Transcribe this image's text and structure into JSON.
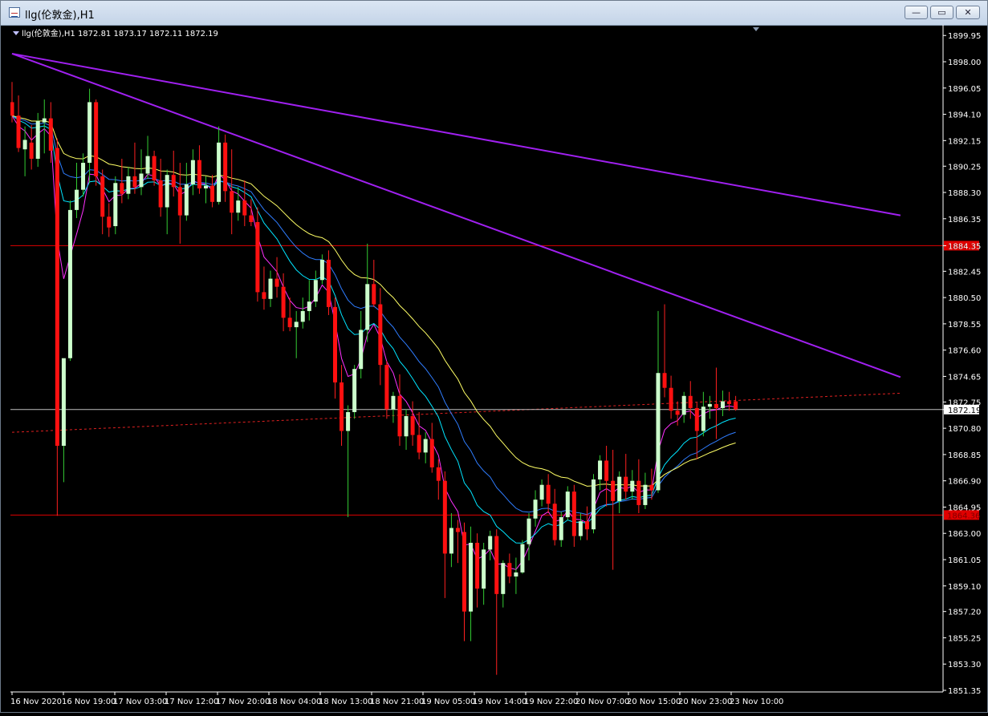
{
  "window": {
    "title": "llg(伦敦金),H1",
    "buttons": {
      "minimize": "—",
      "restore": "▭",
      "close": "✕"
    }
  },
  "chart_data": {
    "type": "candlestick",
    "info_line": "llg(伦敦金),H1  1872.81 1873.17 1872.11 1872.19",
    "ylim": [
      1851.35,
      1900.5
    ],
    "y_ticks": [
      "1899.95",
      "1898.00",
      "1896.05",
      "1894.10",
      "1892.15",
      "1890.25",
      "1888.30",
      "1886.35",
      "1884.35",
      "1882.45",
      "1880.50",
      "1878.55",
      "1876.60",
      "1874.65",
      "1872.75",
      "1872.19",
      "1870.80",
      "1868.85",
      "1866.90",
      "1864.95",
      "1863.00",
      "1861.05",
      "1859.10",
      "1857.20",
      "1855.25",
      "1853.30",
      "1851.35"
    ],
    "x_ticks": [
      "16 Nov 2020",
      "16 Nov 19:00",
      "17 Nov 03:00",
      "17 Nov 12:00",
      "17 Nov 20:00",
      "18 Nov 04:00",
      "18 Nov 13:00",
      "18 Nov 21:00",
      "19 Nov 05:00",
      "19 Nov 14:00",
      "19 Nov 22:00",
      "20 Nov 07:00",
      "20 Nov 15:00",
      "20 Nov 23:00",
      "23 Nov 10:00"
    ],
    "current_price": 1872.19,
    "horizontal_levels": [
      {
        "label": "1884.35",
        "value": 1884.35,
        "color": "#e00000"
      },
      {
        "label": "1864.36",
        "value": 1864.36,
        "color": "#e00000"
      }
    ],
    "trend_lines": [
      {
        "from": [
          0,
          1898.6
        ],
        "to": [
          137.5,
          1886.6
        ],
        "color": "#a020f0"
      },
      {
        "from": [
          0,
          1898.6
        ],
        "to": [
          137.5,
          1874.6
        ],
        "color": "#a020f0"
      },
      {
        "from": [
          0,
          1870.5
        ],
        "to": [
          137.5,
          1873.4
        ],
        "color": "#e02020",
        "dashed": true
      }
    ],
    "ma_colors": [
      "#ff30ff",
      "#00e5ff",
      "#2f7dff",
      "#ffff66"
    ],
    "bull_color": "#ccffcc",
    "bear_color": "#ff1010",
    "candles": [
      [
        1895,
        1896.5,
        1893.5,
        1894
      ],
      [
        1894,
        1895.5,
        1891.3,
        1891.6
      ],
      [
        1891.5,
        1893.2,
        1889.5,
        1892.2
      ],
      [
        1892,
        1893.3,
        1890,
        1890.8
      ],
      [
        1890.8,
        1894.2,
        1890.2,
        1893.6
      ],
      [
        1893.5,
        1895.2,
        1891.2,
        1893.8
      ],
      [
        1893.8,
        1895,
        1890.5,
        1891.4
      ],
      [
        1891.6,
        1892.3,
        1864.3,
        1869.5
      ],
      [
        1869.5,
        1875.5,
        1866.8,
        1876
      ],
      [
        1876,
        1887.7,
        1875.8,
        1887
      ],
      [
        1887,
        1890.5,
        1886.4,
        1888.5
      ],
      [
        1888.5,
        1891.2,
        1888,
        1890.5
      ],
      [
        1890.5,
        1896,
        1889,
        1895
      ],
      [
        1895,
        1895.2,
        1888.8,
        1889.5
      ],
      [
        1889.5,
        1890,
        1885.2,
        1886.5
      ],
      [
        1886.5,
        1887.5,
        1885,
        1885.7
      ],
      [
        1885.8,
        1889.5,
        1885.2,
        1889
      ],
      [
        1889,
        1890.8,
        1887.5,
        1888.2
      ],
      [
        1888.2,
        1890.2,
        1887.8,
        1889.5
      ],
      [
        1889.5,
        1892,
        1888.2,
        1888.7
      ],
      [
        1888.7,
        1891.5,
        1888.1,
        1889.7
      ],
      [
        1889.7,
        1892.5,
        1889.3,
        1891
      ],
      [
        1891,
        1891.4,
        1888.8,
        1889.2
      ],
      [
        1889.2,
        1890.8,
        1886.5,
        1887.2
      ],
      [
        1887.2,
        1890,
        1885.2,
        1889.6
      ],
      [
        1889.6,
        1891.4,
        1888,
        1888.7
      ],
      [
        1888.7,
        1890.5,
        1884.5,
        1886.6
      ],
      [
        1886.6,
        1890.5,
        1886.2,
        1888.9
      ],
      [
        1888.9,
        1891.5,
        1888.1,
        1890.7
      ],
      [
        1890.7,
        1891.8,
        1888.2,
        1888.6
      ],
      [
        1888.6,
        1889.5,
        1887.5,
        1888.8
      ],
      [
        1888.8,
        1889.6,
        1887.2,
        1887.6
      ],
      [
        1887.6,
        1893.2,
        1887.4,
        1892
      ],
      [
        1892,
        1892.6,
        1887.6,
        1888.4
      ],
      [
        1888.4,
        1891.5,
        1885.2,
        1886.8
      ],
      [
        1886.8,
        1888.7,
        1886.2,
        1887.7
      ],
      [
        1887.7,
        1889.2,
        1885.8,
        1886.6
      ],
      [
        1886.6,
        1887.8,
        1885.8,
        1886.1
      ],
      [
        1886.1,
        1887.2,
        1880.2,
        1880.9
      ],
      [
        1880.9,
        1882.8,
        1879.6,
        1880.4
      ],
      [
        1880.4,
        1882.5,
        1879.8,
        1881.9
      ],
      [
        1881.9,
        1883.5,
        1880.5,
        1881.3
      ],
      [
        1881.3,
        1882.3,
        1878,
        1879
      ],
      [
        1879,
        1880.5,
        1878,
        1878.3
      ],
      [
        1878.3,
        1879.5,
        1876,
        1878.7
      ],
      [
        1878.7,
        1880.5,
        1878.2,
        1879.5
      ],
      [
        1879.5,
        1881.8,
        1878.8,
        1880.2
      ],
      [
        1880.2,
        1882.5,
        1879.8,
        1881.8
      ],
      [
        1881.8,
        1883.7,
        1881.5,
        1883.3
      ],
      [
        1883.3,
        1884,
        1879.2,
        1879.8
      ],
      [
        1879.8,
        1880.5,
        1873,
        1874.2
      ],
      [
        1874.2,
        1875.5,
        1869.5,
        1870.6
      ],
      [
        1870.6,
        1872.5,
        1864.2,
        1872
      ],
      [
        1872,
        1875.5,
        1871.5,
        1875.2
      ],
      [
        1875.2,
        1879.5,
        1874.5,
        1878.1
      ],
      [
        1878.1,
        1884.5,
        1877.2,
        1881.5
      ],
      [
        1881.5,
        1883.3,
        1879.8,
        1880
      ],
      [
        1880,
        1881.2,
        1874,
        1875.5
      ],
      [
        1875.5,
        1875.8,
        1871.5,
        1872.2
      ],
      [
        1872.2,
        1873.5,
        1871.2,
        1873.2
      ],
      [
        1873.2,
        1874.8,
        1869.5,
        1870.2
      ],
      [
        1870.2,
        1872.2,
        1869.2,
        1871.7
      ],
      [
        1871.7,
        1872.8,
        1869.5,
        1870.3
      ],
      [
        1870.3,
        1872,
        1868.5,
        1869
      ],
      [
        1869,
        1870.5,
        1868.2,
        1870
      ],
      [
        1870,
        1871.2,
        1867.5,
        1867.9
      ],
      [
        1867.9,
        1868.5,
        1865.5,
        1866.9
      ],
      [
        1866.9,
        1867.6,
        1858.2,
        1861.5
      ],
      [
        1861.5,
        1864.5,
        1860.5,
        1863.4
      ],
      [
        1863.4,
        1864,
        1860.8,
        1863.1
      ],
      [
        1863.1,
        1863.8,
        1855,
        1857.2
      ],
      [
        1857.2,
        1863.5,
        1855,
        1862.3
      ],
      [
        1862.3,
        1863,
        1857.5,
        1858.9
      ],
      [
        1858.9,
        1862.3,
        1857.7,
        1861.8
      ],
      [
        1861.8,
        1863.2,
        1861,
        1862.8
      ],
      [
        1862.8,
        1863.3,
        1852.5,
        1858.5
      ],
      [
        1858.5,
        1861,
        1857.5,
        1860.8
      ],
      [
        1860.8,
        1861.5,
        1859.3,
        1859.8
      ],
      [
        1859.8,
        1861.2,
        1858.5,
        1860.1
      ],
      [
        1860.1,
        1862.5,
        1860,
        1862.2
      ],
      [
        1862.2,
        1864.5,
        1861,
        1864.1
      ],
      [
        1864.1,
        1866.2,
        1863.5,
        1865.5
      ],
      [
        1865.5,
        1867,
        1865,
        1866.6
      ],
      [
        1866.6,
        1867.4,
        1864.5,
        1865.2
      ],
      [
        1865.2,
        1866.3,
        1862.1,
        1862.5
      ],
      [
        1862.5,
        1864.6,
        1862,
        1864.2
      ],
      [
        1864.2,
        1866.5,
        1864,
        1866.1
      ],
      [
        1866.1,
        1866.6,
        1862,
        1862.8
      ],
      [
        1862.8,
        1864.5,
        1862.5,
        1863.9
      ],
      [
        1863.9,
        1865,
        1862.5,
        1863.3
      ],
      [
        1863.3,
        1867.4,
        1863,
        1867
      ],
      [
        1867,
        1868.8,
        1866.2,
        1868.4
      ],
      [
        1868.4,
        1869.5,
        1865,
        1866.9
      ],
      [
        1866.9,
        1869.2,
        1860.3,
        1865.4
      ],
      [
        1865.4,
        1867.6,
        1864.5,
        1867.2
      ],
      [
        1867.2,
        1868.9,
        1865.5,
        1866.1
      ],
      [
        1866.1,
        1867.7,
        1865.5,
        1866.9
      ],
      [
        1866.9,
        1868.5,
        1864.5,
        1865.1
      ],
      [
        1865.1,
        1867.5,
        1864.8,
        1866.6
      ],
      [
        1866.6,
        1867.8,
        1865.5,
        1866.2
      ],
      [
        1866.2,
        1879.5,
        1866,
        1874.9
      ],
      [
        1874.9,
        1880,
        1873.1,
        1873.8
      ],
      [
        1873.8,
        1874.7,
        1871.5,
        1872.1
      ],
      [
        1872.1,
        1872.8,
        1871,
        1871.8
      ],
      [
        1871.8,
        1873.5,
        1871.2,
        1873.2
      ],
      [
        1873.2,
        1874.3,
        1871.5,
        1872.3
      ],
      [
        1872.3,
        1872.7,
        1868.5,
        1870.6
      ],
      [
        1870.6,
        1873.5,
        1870.2,
        1872.4
      ],
      [
        1872.4,
        1873.2,
        1871.5,
        1872.6
      ],
      [
        1872.6,
        1875.3,
        1870,
        1872.3
      ],
      [
        1872.3,
        1873.6,
        1871.7,
        1872.8
      ],
      [
        1872.8,
        1873.5,
        1872.1,
        1872.6
      ],
      [
        1872.8,
        1873.2,
        1872.1,
        1872.2
      ]
    ]
  }
}
